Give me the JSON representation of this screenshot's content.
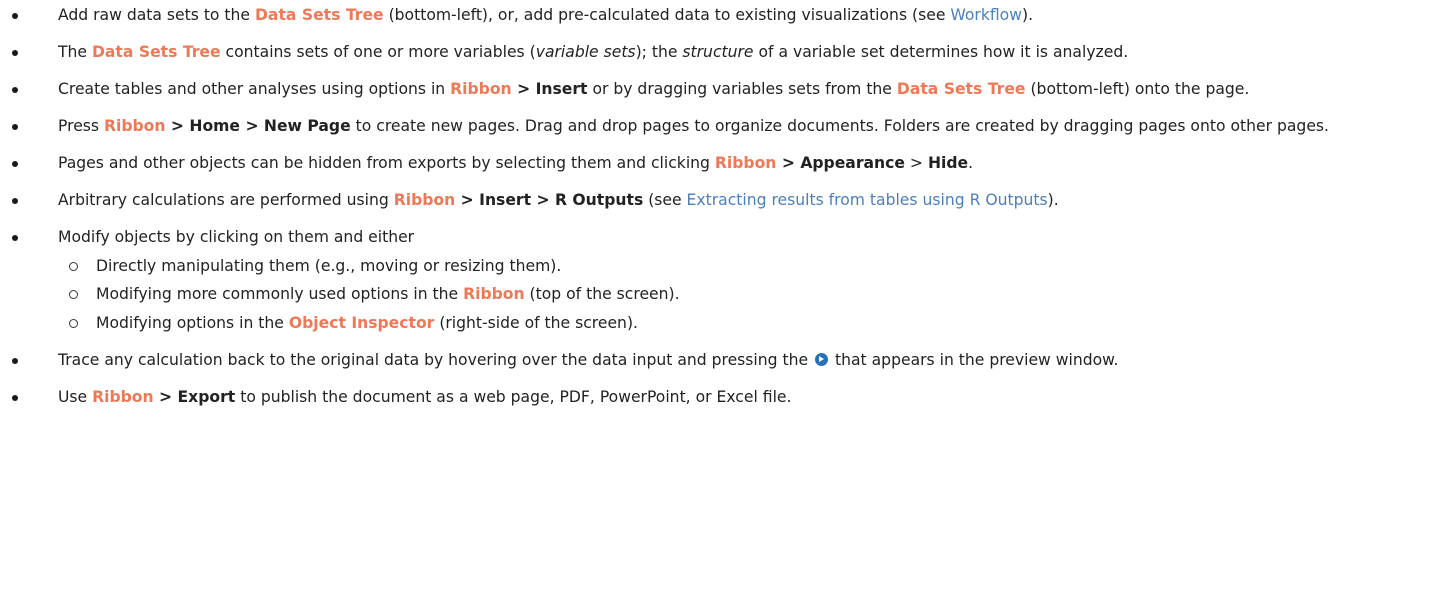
{
  "colors": {
    "emphasis": "#ef7956",
    "link": "#4a7fc1",
    "icon": "#2a6fb8"
  },
  "bullets": [
    {
      "segs": [
        {
          "t": "Add raw data sets to the "
        },
        {
          "t": "Data Sets Tree",
          "s": "o"
        },
        {
          "t": " (bottom-left), or, add pre-calculated data to existing visualizations (see "
        },
        {
          "t": "Workflow",
          "s": "a"
        },
        {
          "t": ")."
        }
      ]
    },
    {
      "segs": [
        {
          "t": "The "
        },
        {
          "t": "Data Sets Tree",
          "s": "o"
        },
        {
          "t": " contains sets of one or more variables ("
        },
        {
          "t": "variable sets",
          "s": "i"
        },
        {
          "t": "); the "
        },
        {
          "t": "structure",
          "s": "i"
        },
        {
          "t": " of a variable set determines how it is analyzed."
        }
      ]
    },
    {
      "segs": [
        {
          "t": "Create tables and other analyses using options in "
        },
        {
          "t": "Ribbon",
          "s": "o"
        },
        {
          "t": " > Insert",
          "s": "b"
        },
        {
          "t": " or by dragging variables sets from the "
        },
        {
          "t": "Data Sets Tree",
          "s": "o"
        },
        {
          "t": " (bottom-left) onto the page."
        }
      ]
    },
    {
      "segs": [
        {
          "t": "Press "
        },
        {
          "t": "Ribbon",
          "s": "o"
        },
        {
          "t": " > Home > New Page",
          "s": "b"
        },
        {
          "t": " to create new pages. Drag and drop pages to organize documents. Folders are created by dragging pages onto other pages."
        }
      ]
    },
    {
      "segs": [
        {
          "t": "Pages and other objects can be hidden from exports by selecting them and clicking "
        },
        {
          "t": "Ribbon",
          "s": "o"
        },
        {
          "t": " > Appearance",
          "s": "b"
        },
        {
          "t": " > "
        },
        {
          "t": "Hide",
          "s": "b"
        },
        {
          "t": "."
        }
      ]
    },
    {
      "segs": [
        {
          "t": "Arbitrary calculations are performed using "
        },
        {
          "t": "Ribbon",
          "s": "o"
        },
        {
          "t": " > Insert > R Outputs",
          "s": "b"
        },
        {
          "t": " (see "
        },
        {
          "t": "Extracting results from tables using R Outputs",
          "s": "a"
        },
        {
          "t": ")."
        }
      ]
    },
    {
      "segs": [
        {
          "t": "Modify objects by clicking on them and either"
        }
      ],
      "sub": [
        {
          "segs": [
            {
              "t": "Directly manipulating them (e.g., moving or resizing them)."
            }
          ]
        },
        {
          "segs": [
            {
              "t": "Modifying more commonly used options in the "
            },
            {
              "t": "Ribbon",
              "s": "o"
            },
            {
              "t": " (top of the screen)."
            }
          ]
        },
        {
          "segs": [
            {
              "t": "Modifying options in the "
            },
            {
              "t": "Object Inspector",
              "s": "o"
            },
            {
              "t": " (right-side of the screen)."
            }
          ]
        }
      ]
    },
    {
      "segs": [
        {
          "t": "Trace any calculation back to the original data by hovering over the data input and pressing the "
        },
        {
          "icon": "circle-arrow-right-icon"
        },
        {
          "t": " that appears in the preview window."
        }
      ]
    },
    {
      "segs": [
        {
          "t": "Use "
        },
        {
          "t": "Ribbon",
          "s": "o"
        },
        {
          "t": " > Export",
          "s": "b"
        },
        {
          "t": " to publish the document as a web page, PDF, PowerPoint, or Excel file."
        }
      ]
    }
  ]
}
